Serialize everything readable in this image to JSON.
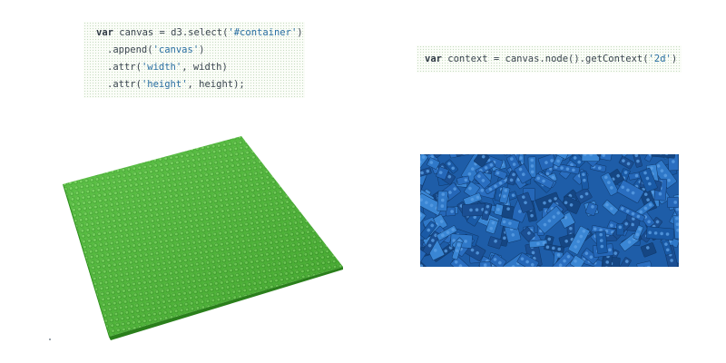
{
  "code_block_1": {
    "lines": [
      {
        "keyword": "var",
        "plain": " canvas = d3.select(",
        "string": "'#container'",
        "tail": ")"
      },
      {
        "keyword": "",
        "plain": ".append(",
        "string": "'canvas'",
        "tail": ")"
      },
      {
        "keyword": "",
        "plain": ".attr(",
        "string": "'width'",
        "tail": ", width)"
      },
      {
        "keyword": "",
        "plain": ".attr(",
        "string": "'height'",
        "tail": ", height);"
      }
    ]
  },
  "code_block_2": {
    "lines": [
      {
        "keyword": "var",
        "plain": " context = canvas.node().getContext(",
        "string": "'2d'",
        "tail": ")"
      }
    ]
  },
  "images": {
    "left": "green-lego-baseplate",
    "right": "pile-of-blue-lego-bricks"
  },
  "colors": {
    "code_background": "#fbfdf8",
    "code_text": "#3b4650",
    "code_string": "#2a6fa3",
    "plate_green": "#4cbc34",
    "bricks_blue": "#1e5da8"
  }
}
